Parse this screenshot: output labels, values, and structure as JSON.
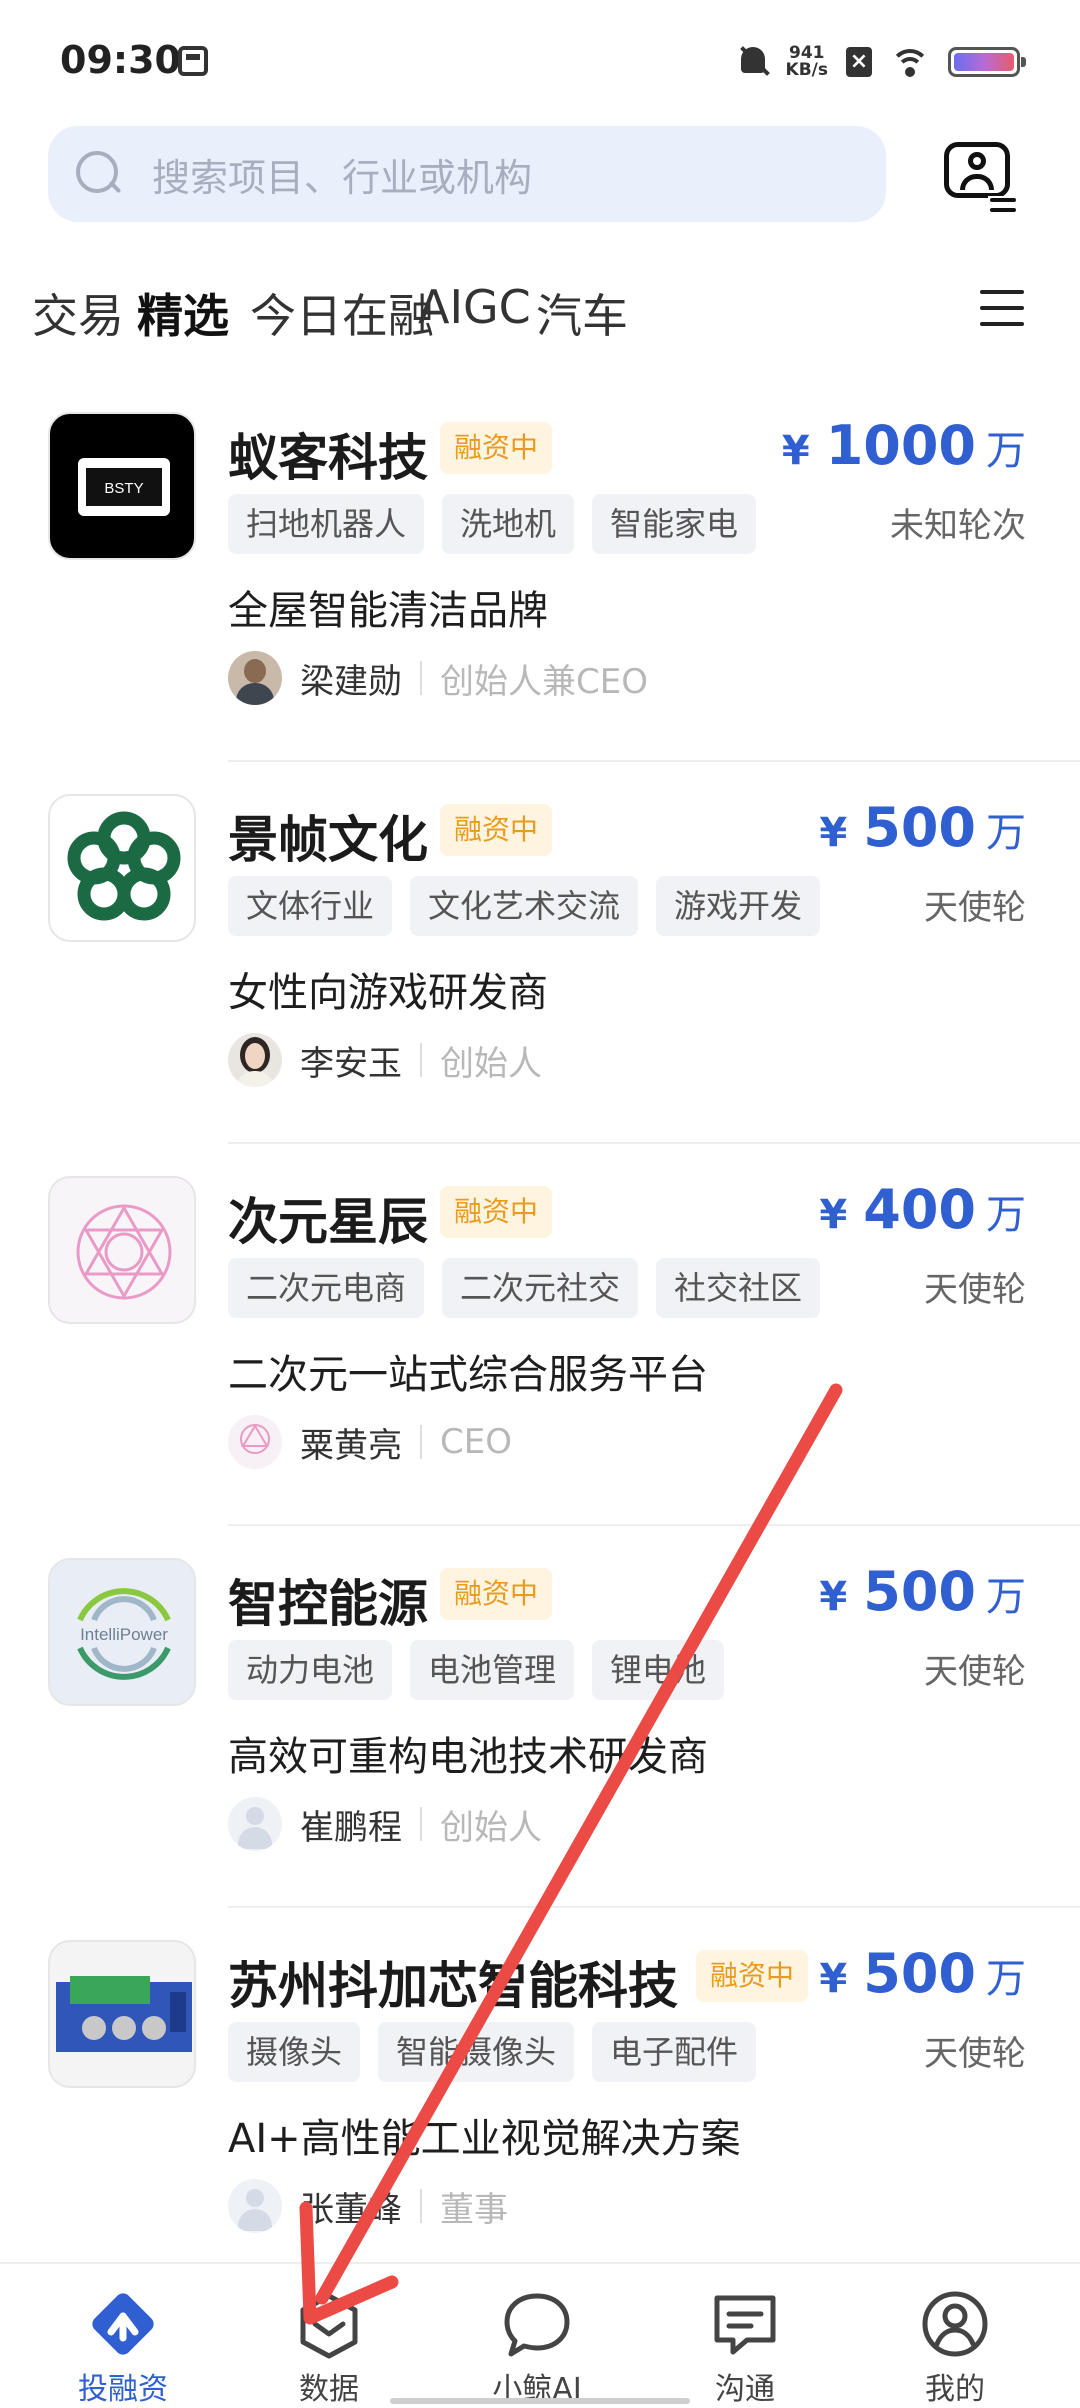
{
  "status_bar": {
    "time": "09:30",
    "net_speed_value": "941",
    "net_speed_unit": "KB/s",
    "icons": [
      "sim-card-icon",
      "bell-off-icon",
      "close-box-icon",
      "wifi-icon",
      "battery-icon"
    ]
  },
  "search": {
    "placeholder": "搜索项目、行业或机构"
  },
  "header": {
    "switch_icon": "user-switch-icon"
  },
  "category_tabs": [
    {
      "label": "交易",
      "active": false
    },
    {
      "label": "精选",
      "active": true
    },
    {
      "label": "今日在融",
      "active": false
    },
    {
      "label": "AIGC",
      "active": false
    },
    {
      "label": "汽车",
      "active": false
    }
  ],
  "companies": [
    {
      "name": "蚁客科技",
      "status": "融资中",
      "currency": "¥",
      "amount": "1000",
      "unit": "万",
      "round": "未知轮次",
      "tags": [
        "扫地机器人",
        "洗地机",
        "智能家电"
      ],
      "description": "全屋智能清洁品牌",
      "founder_name": "梁建勋",
      "founder_role": "创始人兼CEO",
      "logo_text": "BSTY"
    },
    {
      "name": "景帧文化",
      "status": "融资中",
      "currency": "¥",
      "amount": "500",
      "unit": "万",
      "round": "天使轮",
      "tags": [
        "文体行业",
        "文化艺术交流",
        "游戏开发"
      ],
      "description": "女性向游戏研发商",
      "founder_name": "李安玉",
      "founder_role": "创始人"
    },
    {
      "name": "次元星辰",
      "status": "融资中",
      "currency": "¥",
      "amount": "400",
      "unit": "万",
      "round": "天使轮",
      "tags": [
        "二次元电商",
        "二次元社交",
        "社交社区"
      ],
      "description": "二次元一站式综合服务平台",
      "founder_name": "粟黄亮",
      "founder_role": "CEO"
    },
    {
      "name": "智控能源",
      "status": "融资中",
      "currency": "¥",
      "amount": "500",
      "unit": "万",
      "round": "天使轮",
      "tags": [
        "动力电池",
        "电池管理",
        "锂电池"
      ],
      "description": "高效可重构电池技术研发商",
      "founder_name": "崔鹏程",
      "founder_role": "创始人",
      "logo_text": "IntelliPower"
    },
    {
      "name": "苏州抖加芯智能科技",
      "status": "融资中",
      "currency": "¥",
      "amount": "500",
      "unit": "万",
      "round": "天使轮",
      "tags": [
        "摄像头",
        "智能摄像头",
        "电子配件"
      ],
      "description": "AI+高性能工业视觉解决方案",
      "founder_name": "张董峰",
      "founder_role": "董事"
    }
  ],
  "bottom_nav": [
    {
      "label": "投融资",
      "icon": "invest-icon",
      "active": true
    },
    {
      "label": "数据",
      "icon": "data-icon",
      "active": false
    },
    {
      "label": "小鲸AI",
      "icon": "chat-bubble-icon",
      "active": false
    },
    {
      "label": "沟通",
      "icon": "message-icon",
      "active": false
    },
    {
      "label": "我的",
      "icon": "profile-icon",
      "active": false
    }
  ],
  "colors": {
    "accent": "#2f5fd0",
    "badge_bg": "#fff4e0",
    "badge_text": "#e89b1e",
    "annotation_arrow": "#ec4a45"
  }
}
